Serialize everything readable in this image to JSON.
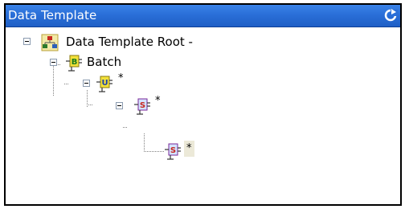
{
  "panel": {
    "title": "Data Template"
  },
  "tree": {
    "root": {
      "label": "Data Template Root -",
      "icon": "org-chart-icon"
    },
    "batch": {
      "label": "Batch",
      "icon": "batch-node-icon"
    },
    "level2": {
      "label": "*",
      "icon": "u-node-icon"
    },
    "level3": {
      "label": "*",
      "icon": "s-node-icon"
    },
    "level4": {
      "label": "*",
      "icon": "s-node-icon"
    }
  }
}
